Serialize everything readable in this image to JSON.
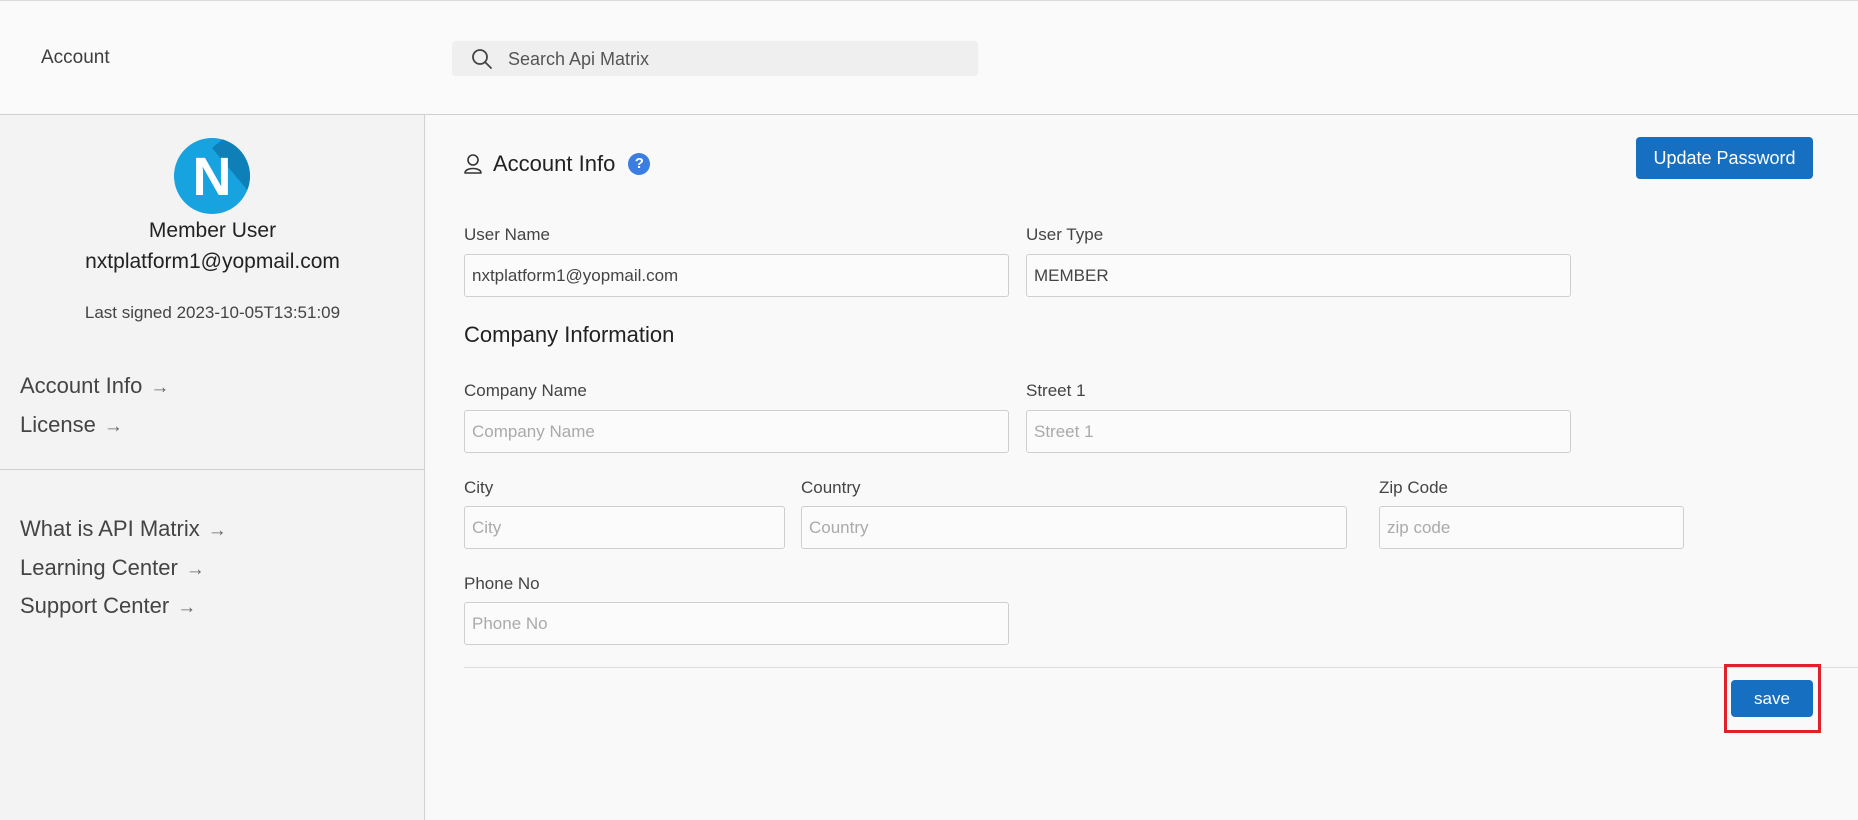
{
  "header": {
    "breadcrumb": "Account",
    "search_placeholder": "Search Api Matrix"
  },
  "sidebar": {
    "avatar_letter": "N",
    "user_name": "Member User",
    "email": "nxtplatform1@yopmail.com",
    "last_signed": "Last signed 2023-10-05T13:51:09",
    "arrow": "→",
    "account_links": [
      {
        "label": "Account Info"
      },
      {
        "label": "License"
      }
    ],
    "help_links": [
      {
        "label": "What is API Matrix"
      },
      {
        "label": "Learning Center"
      },
      {
        "label": "Support Center"
      }
    ]
  },
  "main": {
    "section_title": "Account Info",
    "help_glyph": "?",
    "update_password_label": "Update Password",
    "company_title": "Company Information",
    "save_label": "save",
    "fields": {
      "user_name": {
        "label": "User Name",
        "value": "nxtplatform1@yopmail.com"
      },
      "user_type": {
        "label": "User Type",
        "value": "MEMBER"
      },
      "company_name": {
        "label": "Company Name",
        "placeholder": "Company Name"
      },
      "street1": {
        "label": "Street 1",
        "placeholder": "Street 1"
      },
      "city": {
        "label": "City",
        "placeholder": "City"
      },
      "country": {
        "label": "Country",
        "placeholder": "Country"
      },
      "zip": {
        "label": "Zip Code",
        "placeholder": "zip code"
      },
      "phone": {
        "label": "Phone No",
        "placeholder": "Phone No"
      }
    }
  },
  "colors": {
    "primary_button": "#176fc1",
    "avatar": "#17a2e0",
    "help_badge": "#3b7de0",
    "highlight_box": "#e0202a"
  }
}
